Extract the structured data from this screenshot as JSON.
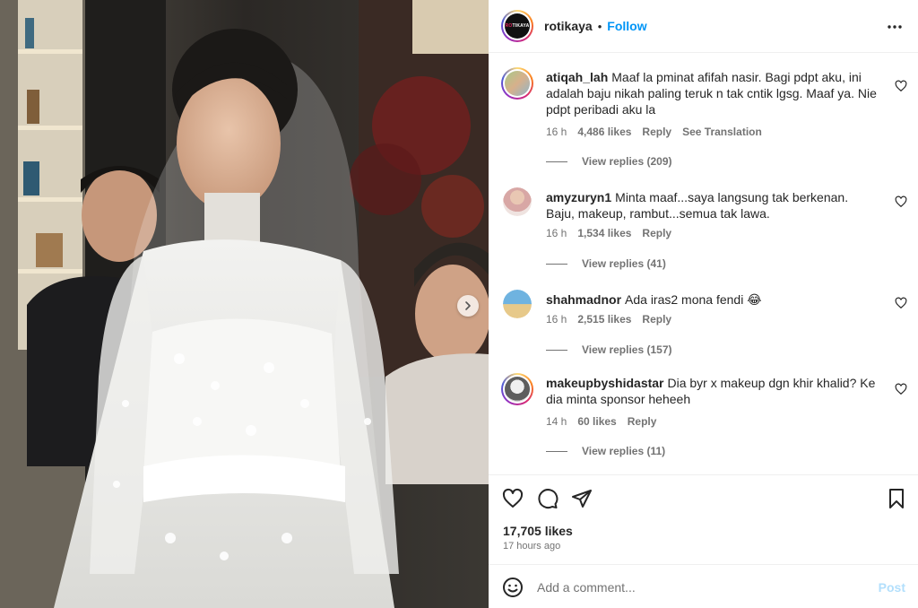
{
  "post": {
    "username": "rotikaya",
    "separator": "•",
    "follow_label": "Follow",
    "avatar_logo": {
      "prefix": "RO",
      "suffix": "TIKAYA"
    },
    "likes": "17,705 likes",
    "time_ago": "17 hours ago"
  },
  "comments": [
    {
      "username": "atiqah_lah",
      "text": "Maaf la pminat afifah nasir. Bagi pdpt aku, ini adalah baju nikah paling teruk n tak cntik lgsg. Maaf ya. Nie pdpt peribadi aku la",
      "time": "16 h",
      "likes": "4,486 likes",
      "reply_label": "Reply",
      "translate_label": "See Translation",
      "view_replies": "View replies (209)"
    },
    {
      "username": "amyzuryn1",
      "text": "Minta maaf...saya langsung tak berkenan. Baju, makeup, rambut...semua tak lawa.",
      "time": "16 h",
      "likes": "1,534 likes",
      "reply_label": "Reply",
      "view_replies": "View replies (41)"
    },
    {
      "username": "shahmadnor",
      "text": "Ada iras2 mona fendi 😂",
      "time": "16 h",
      "likes": "2,515 likes",
      "reply_label": "Reply",
      "view_replies": "View replies (157)"
    },
    {
      "username": "makeupbyshidastar",
      "text": "Dia byr x makeup dgn khir khalid? Ke dia minta sponsor heheeh",
      "time": "14 h",
      "likes": "60 likes",
      "reply_label": "Reply",
      "view_replies": "View replies (11)"
    }
  ],
  "composer": {
    "placeholder": "Add a comment...",
    "post_label": "Post"
  },
  "icons": {
    "header_more": "more-horizontal-icon",
    "carousel_next": "chevron-right-icon",
    "like": "heart-icon",
    "comment": "comment-bubble-icon",
    "share": "paper-plane-icon",
    "save": "bookmark-icon",
    "emoji": "smiley-icon"
  },
  "colors": {
    "accent": "#0095f6",
    "post_disabled": "#b2dffc",
    "muted": "#737373",
    "text": "#262626"
  }
}
